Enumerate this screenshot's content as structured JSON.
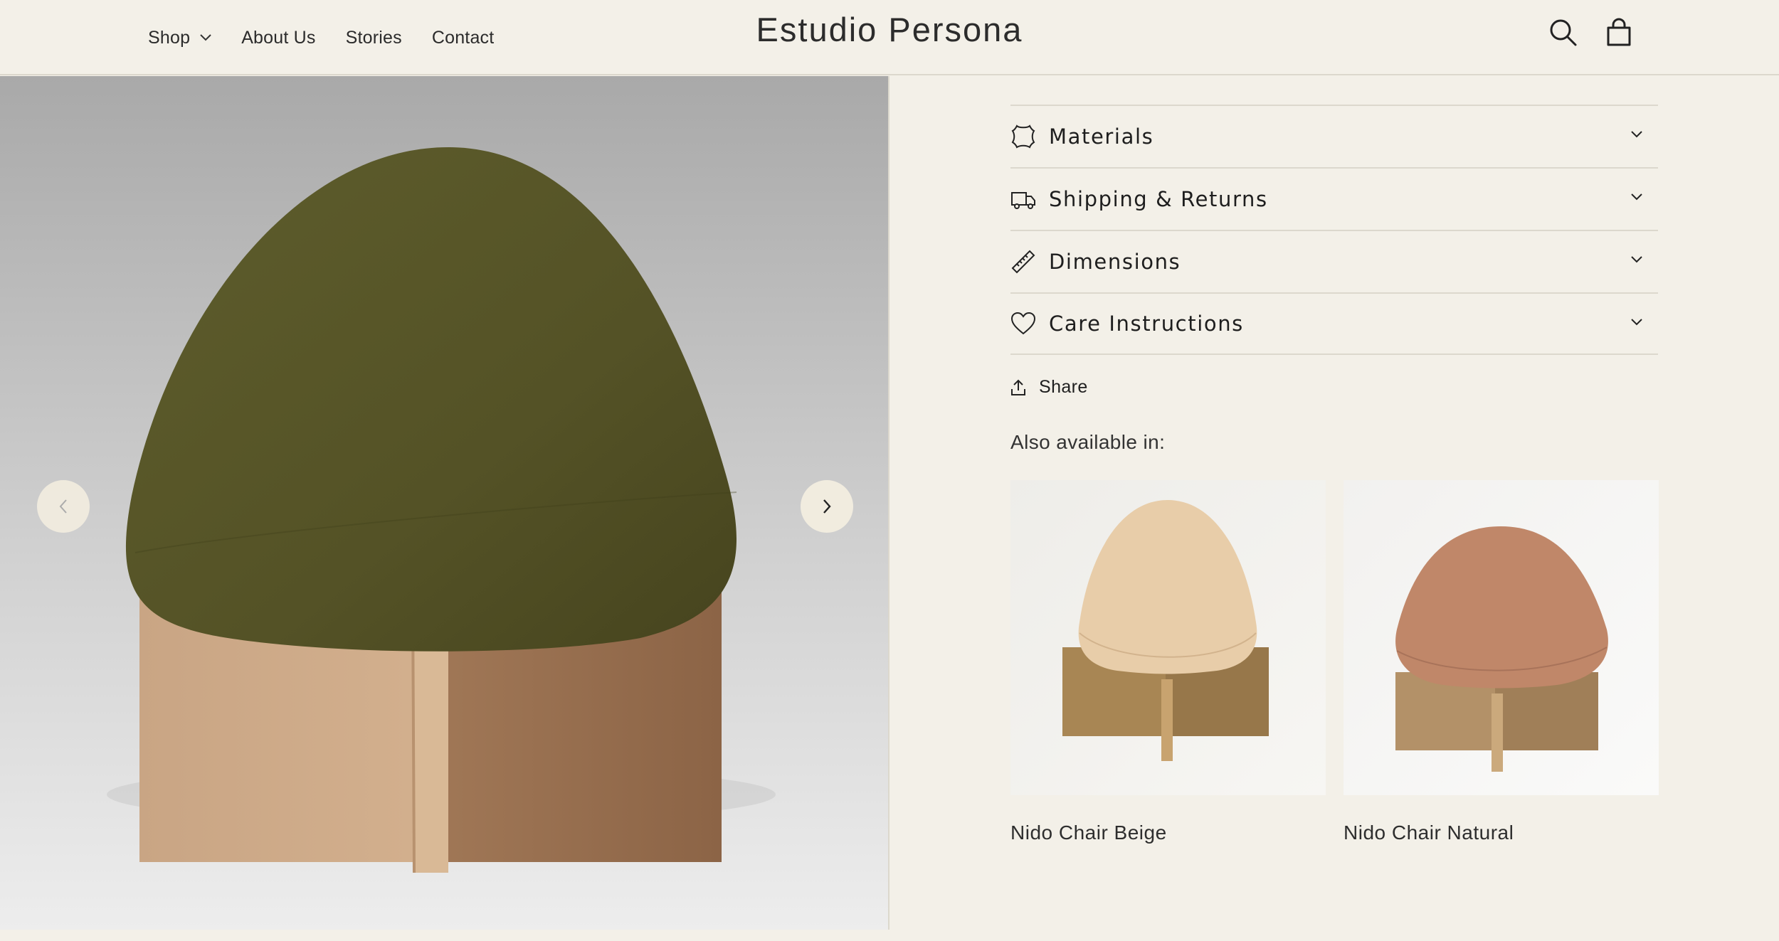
{
  "header": {
    "brand": "Estudio Persona",
    "nav": [
      {
        "label": "Shop",
        "has_dropdown": true
      },
      {
        "label": "About Us",
        "has_dropdown": false
      },
      {
        "label": "Stories",
        "has_dropdown": false
      },
      {
        "label": "Contact",
        "has_dropdown": false
      }
    ],
    "icons": [
      "search-icon",
      "cart-icon"
    ]
  },
  "gallery": {
    "prev_icon": "chevron-left-icon",
    "next_icon": "chevron-right-icon"
  },
  "product_info": {
    "accordion": [
      {
        "label": "Materials",
        "icon": "leather-icon"
      },
      {
        "label": "Shipping & Returns",
        "icon": "truck-icon"
      },
      {
        "label": "Dimensions",
        "icon": "ruler-icon"
      },
      {
        "label": "Care Instructions",
        "icon": "heart-icon"
      }
    ],
    "share_label": "Share",
    "also_available_title": "Also available in:",
    "variants": [
      {
        "name": "Nido Chair Beige"
      },
      {
        "name": "Nido Chair Natural"
      }
    ]
  },
  "colors": {
    "background": "#f3f0e8",
    "divider": "#dcd8cd",
    "chair_main": "#5a5a28",
    "chair_beige": "#e6c9a4",
    "chair_natural": "#c28a6a",
    "wood": "#c9a37f"
  }
}
